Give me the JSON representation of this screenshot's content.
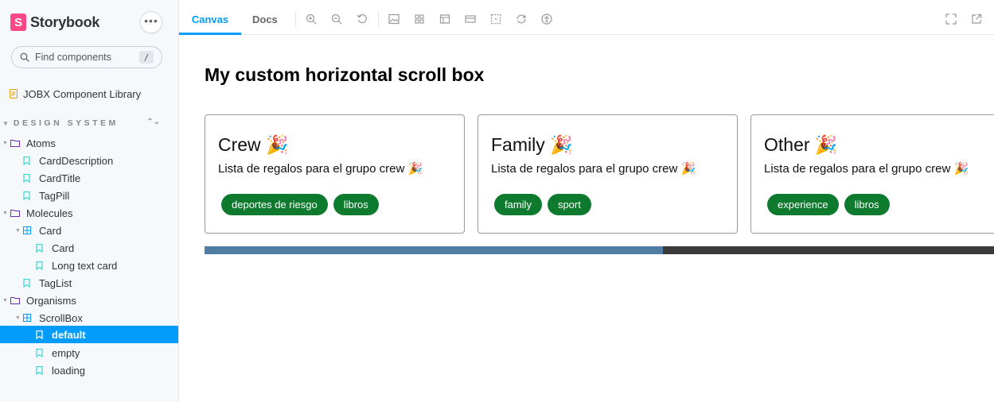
{
  "brand": {
    "name": "Storybook",
    "logo_letter": "S",
    "logo_color": "#ff4785"
  },
  "sidebar": {
    "menu_dots": "•••",
    "search": {
      "placeholder": "Find components",
      "shortcut": "/"
    },
    "doc_link": "JOBX Component Library",
    "section_title": "DESIGN SYSTEM",
    "tree": [
      {
        "label": "Atoms",
        "type": "folder"
      },
      {
        "label": "CardDescription",
        "type": "story"
      },
      {
        "label": "CardTitle",
        "type": "story"
      },
      {
        "label": "TagPill",
        "type": "story"
      },
      {
        "label": "Molecules",
        "type": "folder"
      },
      {
        "label": "Card",
        "type": "component"
      },
      {
        "label": "Card",
        "type": "story"
      },
      {
        "label": "Long text card",
        "type": "story"
      },
      {
        "label": "TagList",
        "type": "story"
      },
      {
        "label": "Organisms",
        "type": "folder"
      },
      {
        "label": "ScrollBox",
        "type": "component"
      },
      {
        "label": "default",
        "type": "story",
        "selected": true
      },
      {
        "label": "empty",
        "type": "story"
      },
      {
        "label": "loading",
        "type": "story"
      }
    ]
  },
  "toolbar": {
    "tabs": [
      {
        "label": "Canvas",
        "active": true
      },
      {
        "label": "Docs",
        "active": false
      }
    ],
    "accent_color": "#029cfd"
  },
  "canvas": {
    "title": "My custom horizontal scroll box",
    "cards": [
      {
        "title": "Crew 🎉",
        "description": "Lista de regalos para el grupo crew 🎉",
        "tags": [
          "deportes de riesgo",
          "libros"
        ]
      },
      {
        "title": "Family 🎉",
        "description": "Lista de regalos para el grupo crew 🎉",
        "tags": [
          "family",
          "sport"
        ]
      },
      {
        "title": "Other 🎉",
        "description": "Lista de regalos para el grupo crew 🎉",
        "tags": [
          "experience",
          "libros"
        ]
      }
    ],
    "pill_color": "#0d7a2d",
    "scroll_position": 0.58
  }
}
